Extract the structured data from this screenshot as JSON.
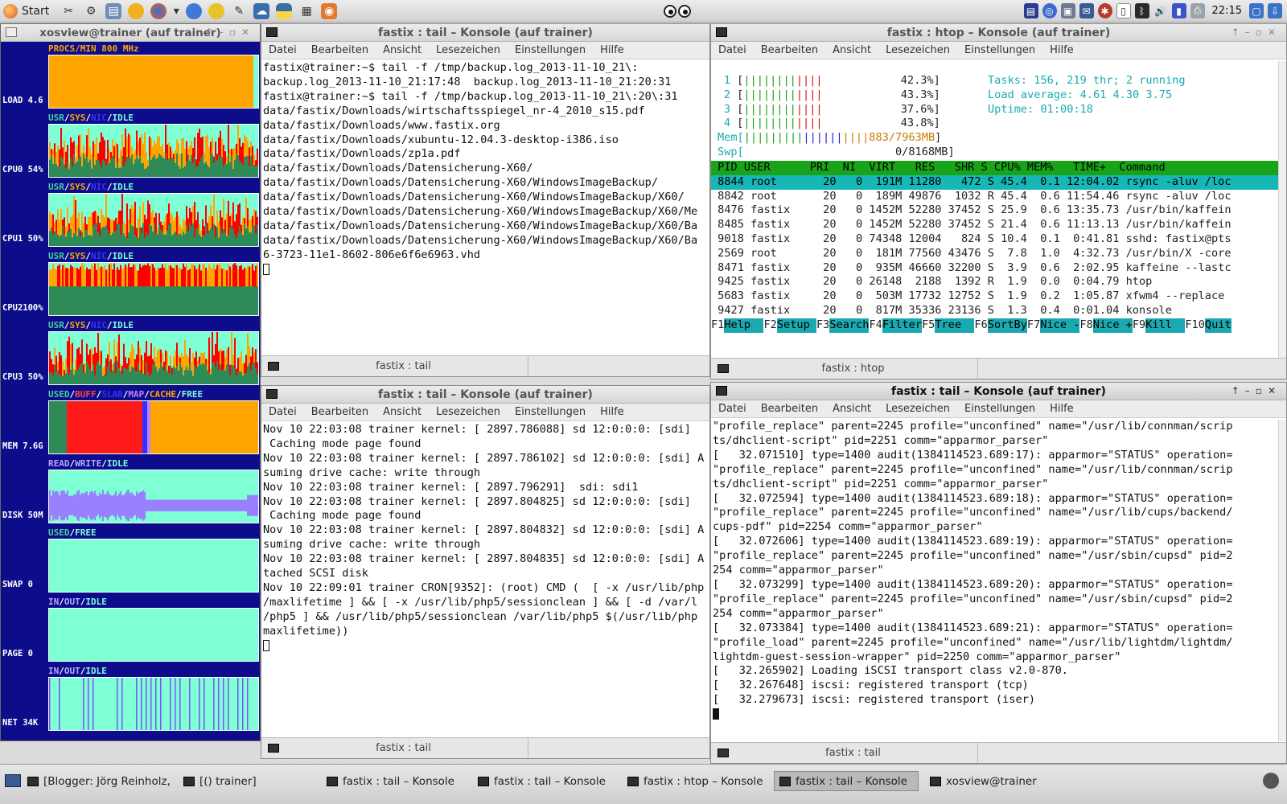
{
  "top_panel": {
    "start_label": "Start",
    "launchers": [
      "tools-icon",
      "settings-icon",
      "filemanager-icon",
      "shell-icon",
      "firefox-icon",
      "chromium-icon",
      "network-icon",
      "editor-icon",
      "cloud-icon",
      "python-icon",
      "notes-icon",
      "document-icon"
    ],
    "clock": "22:15"
  },
  "xosview": {
    "title": "xosview@trainer (auf trainer)",
    "meters": [
      {
        "label": "PROCS/MIN 800 MHz",
        "side": "LOAD 4.6"
      },
      {
        "label_parts": [
          "USR",
          "/",
          "SYS",
          "/",
          "NIC",
          "/",
          "IDLE"
        ],
        "side": "CPU0 54%"
      },
      {
        "label_parts": [
          "USR",
          "/",
          "SYS",
          "/",
          "NIC",
          "/",
          "IDLE"
        ],
        "side": "CPU1 50%"
      },
      {
        "label_parts": [
          "USR",
          "/",
          "SYS",
          "/",
          "NIC",
          "/",
          "IDLE"
        ],
        "side": "CPU2100%"
      },
      {
        "label_parts": [
          "USR",
          "/",
          "SYS",
          "/",
          "NIC",
          "/",
          "IDLE"
        ],
        "side": "CPU3 50%"
      },
      {
        "label_parts": [
          "USED",
          "/",
          "BUFF",
          "/",
          "SLAB",
          "/",
          "MAP",
          "/",
          "CACHE",
          "/",
          "FREE"
        ],
        "side": "MEM 7.6G"
      },
      {
        "label_parts": [
          "READ",
          "/",
          "WRITE",
          "/",
          "IDLE"
        ],
        "side": "DISK 50M"
      },
      {
        "label_parts": [
          "USED",
          "/",
          "FREE"
        ],
        "side": "SWAP    0"
      },
      {
        "label_parts": [
          "IN",
          "/",
          "OUT",
          "/",
          "IDLE"
        ],
        "side": "PAGE    0"
      },
      {
        "label_parts": [
          "IN",
          "/",
          "OUT",
          "/",
          "IDLE"
        ],
        "side": "NET  34K"
      }
    ]
  },
  "tail1": {
    "title": "fastix : tail – Konsole (auf trainer)",
    "menu": [
      "Datei",
      "Bearbeiten",
      "Ansicht",
      "Lesezeichen",
      "Einstellungen",
      "Hilfe"
    ],
    "lines": [
      "fastix@trainer:~$ tail -f /tmp/backup.log_2013-11-10_21\\:",
      "backup.log_2013-11-10_21:17:48  backup.log_2013-11-10_21:20:31",
      "fastix@trainer:~$ tail -f /tmp/backup.log_2013-11-10_21\\:20\\:31",
      "data/fastix/Downloads/wirtschaftsspiegel_nr-4_2010_s15.pdf",
      "data/fastix/Downloads/www.fastix.org",
      "data/fastix/Downloads/xubuntu-12.04.3-desktop-i386.iso",
      "data/fastix/Downloads/zp1a.pdf",
      "data/fastix/Downloads/Datensicherung-X60/",
      "data/fastix/Downloads/Datensicherung-X60/WindowsImageBackup/",
      "data/fastix/Downloads/Datensicherung-X60/WindowsImageBackup/X60/",
      "data/fastix/Downloads/Datensicherung-X60/WindowsImageBackup/X60/Me",
      "data/fastix/Downloads/Datensicherung-X60/WindowsImageBackup/X60/Ba",
      "data/fastix/Downloads/Datensicherung-X60/WindowsImageBackup/X60/Ba",
      "6-3723-11e1-8602-806e6f6e6963.vhd"
    ],
    "tab_label": "fastix : tail"
  },
  "htop": {
    "title": "fastix : htop – Konsole (auf trainer)",
    "menu": [
      "Datei",
      "Bearbeiten",
      "Ansicht",
      "Lesezeichen",
      "Einstellungen",
      "Hilfe"
    ],
    "cpus": [
      {
        "n": "1",
        "pct": "42.3%"
      },
      {
        "n": "2",
        "pct": "43.3%"
      },
      {
        "n": "3",
        "pct": "37.6%"
      },
      {
        "n": "4",
        "pct": "43.8%"
      }
    ],
    "mem": "883/7963MB",
    "swp": "0/8168MB",
    "tasks": "Tasks: 156, 219 thr; 2 running",
    "load": "Load average: 4.61 4.30 3.75",
    "uptime": "Uptime: 01:00:18",
    "header": " PID USER      PRI  NI  VIRT   RES   SHR S CPU% MEM%   TIME+  Command",
    "rows": [
      " 8844 root       20   0  191M 11280   472 S 45.4  0.1 12:04.02 rsync -aluv /loc",
      " 8842 root       20   0  189M 49876  1032 R 45.4  0.6 11:54.46 rsync -aluv /loc",
      " 8476 fastix     20   0 1452M 52280 37452 S 25.9  0.6 13:35.73 /usr/bin/kaffein",
      " 8485 fastix     20   0 1452M 52280 37452 S 21.4  0.6 11:13.13 /usr/bin/kaffein",
      " 9018 fastix     20   0 74348 12004   824 S 10.4  0.1  0:41.81 sshd: fastix@pts",
      " 2569 root       20   0  181M 77560 43476 S  7.8  1.0  4:32.73 /usr/bin/X -core",
      " 8471 fastix     20   0  935M 46660 32200 S  3.9  0.6  2:02.95 kaffeine --lastc",
      " 9425 fastix     20   0 26148  2188  1392 R  1.9  0.0  0:04.79 htop",
      " 5683 fastix     20   0  503M 17732 12752 S  1.9  0.2  1:05.87 xfwm4 --replace",
      " 9427 fastix     20   0  817M 35336 23136 S  1.3  0.4  0:01.04 konsole"
    ],
    "fkeys": [
      {
        "k": "F1",
        "l": "Help  "
      },
      {
        "k": "F2",
        "l": "Setup "
      },
      {
        "k": "F3",
        "l": "Search"
      },
      {
        "k": "F4",
        "l": "Filter"
      },
      {
        "k": "F5",
        "l": "Tree  "
      },
      {
        "k": "F6",
        "l": "SortBy"
      },
      {
        "k": "F7",
        "l": "Nice -"
      },
      {
        "k": "F8",
        "l": "Nice +"
      },
      {
        "k": "F9",
        "l": "Kill  "
      },
      {
        "k": "F10",
        "l": "Quit"
      }
    ],
    "tab_label": "fastix : htop"
  },
  "tail2": {
    "title": "fastix : tail – Konsole (auf trainer)",
    "menu": [
      "Datei",
      "Bearbeiten",
      "Ansicht",
      "Lesezeichen",
      "Einstellungen",
      "Hilfe"
    ],
    "lines": [
      "Nov 10 22:03:08 trainer kernel: [ 2897.786088] sd 12:0:0:0: [sdi] ",
      " Caching mode page found",
      "Nov 10 22:03:08 trainer kernel: [ 2897.786102] sd 12:0:0:0: [sdi] A",
      "suming drive cache: write through",
      "Nov 10 22:03:08 trainer kernel: [ 2897.796291]  sdi: sdi1",
      "Nov 10 22:03:08 trainer kernel: [ 2897.804825] sd 12:0:0:0: [sdi] ",
      " Caching mode page found",
      "Nov 10 22:03:08 trainer kernel: [ 2897.804832] sd 12:0:0:0: [sdi] A",
      "suming drive cache: write through",
      "Nov 10 22:03:08 trainer kernel: [ 2897.804835] sd 12:0:0:0: [sdi] A",
      "tached SCSI disk",
      "Nov 10 22:09:01 trainer CRON[9352]: (root) CMD (  [ -x /usr/lib/php",
      "/maxlifetime ] && [ -x /usr/lib/php5/sessionclean ] && [ -d /var/l",
      "/php5 ] && /usr/lib/php5/sessionclean /var/lib/php5 $(/usr/lib/php",
      "maxlifetime))"
    ],
    "tab_label": "fastix : tail"
  },
  "tail3": {
    "title": "fastix : tail – Konsole (auf trainer)",
    "menu": [
      "Datei",
      "Bearbeiten",
      "Ansicht",
      "Lesezeichen",
      "Einstellungen",
      "Hilfe"
    ],
    "lines": [
      "\"profile_replace\" parent=2245 profile=\"unconfined\" name=\"/usr/lib/connman/scrip",
      "ts/dhclient-script\" pid=2251 comm=\"apparmor_parser\"",
      "[   32.071510] type=1400 audit(1384114523.689:17): apparmor=\"STATUS\" operation=",
      "\"profile_replace\" parent=2245 profile=\"unconfined\" name=\"/usr/lib/connman/scrip",
      "ts/dhclient-script\" pid=2251 comm=\"apparmor_parser\"",
      "[   32.072594] type=1400 audit(1384114523.689:18): apparmor=\"STATUS\" operation=",
      "\"profile_replace\" parent=2245 profile=\"unconfined\" name=\"/usr/lib/cups/backend/",
      "cups-pdf\" pid=2254 comm=\"apparmor_parser\"",
      "[   32.072606] type=1400 audit(1384114523.689:19): apparmor=\"STATUS\" operation=",
      "\"profile_replace\" parent=2245 profile=\"unconfined\" name=\"/usr/sbin/cupsd\" pid=2",
      "254 comm=\"apparmor_parser\"",
      "[   32.073299] type=1400 audit(1384114523.689:20): apparmor=\"STATUS\" operation=",
      "\"profile_replace\" parent=2245 profile=\"unconfined\" name=\"/usr/sbin/cupsd\" pid=2",
      "254 comm=\"apparmor_parser\"",
      "[   32.073384] type=1400 audit(1384114523.689:21): apparmor=\"STATUS\" operation=",
      "\"profile_load\" parent=2245 profile=\"unconfined\" name=\"/usr/lib/lightdm/lightdm/",
      "lightdm-guest-session-wrapper\" pid=2250 comm=\"apparmor_parser\"",
      "[   32.265902] Loading iSCSI transport class v2.0-870.",
      "[   32.267648] iscsi: registered transport (tcp)",
      "[   32.279673] iscsi: registered transport (iser)"
    ],
    "tab_label": "fastix : tail"
  },
  "taskbar": {
    "items": [
      {
        "label": "[Blogger: Jörg Reinholz, ...",
        "active": false
      },
      {
        "label": "[() trainer]",
        "active": false
      },
      {
        "label": "fastix : tail – Konsole",
        "active": false
      },
      {
        "label": "fastix : tail – Konsole",
        "active": false
      },
      {
        "label": "fastix : htop – Konsole",
        "active": false
      },
      {
        "label": "fastix : tail – Konsole",
        "active": true
      },
      {
        "label": "xosview@trainer",
        "active": false
      }
    ]
  },
  "colors": {
    "xosview_bg": "#0d0d8c",
    "cpu_green": "#2e8b57",
    "cpu_orange": "#ffa500",
    "cpu_red": "#ff0000",
    "idle_aqua": "#7fffd4",
    "htop_header": "#19a319",
    "htop_selected": "#17b7b7"
  }
}
